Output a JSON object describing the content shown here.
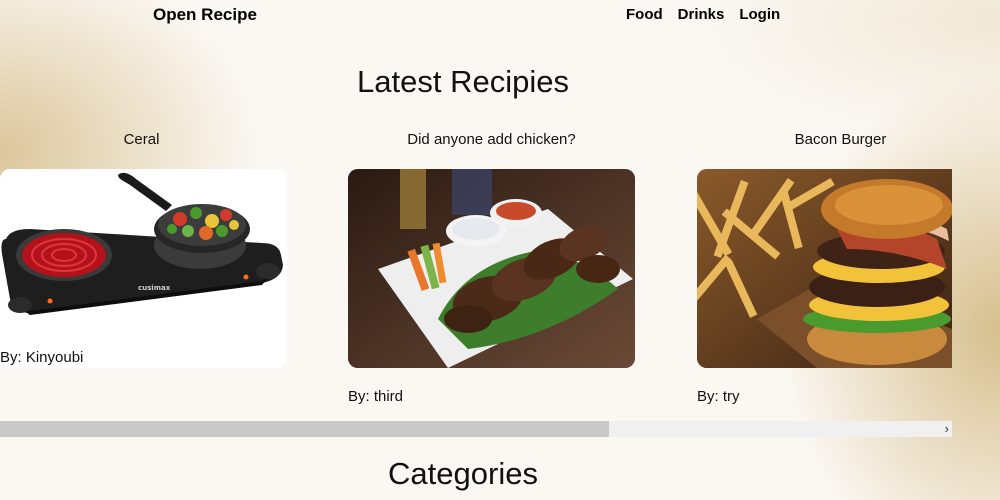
{
  "nav": {
    "brand": "Open Recipe",
    "links": [
      {
        "label": "Food"
      },
      {
        "label": "Drinks"
      },
      {
        "label": "Login"
      }
    ]
  },
  "latest": {
    "title": "Latest Recipies",
    "cards": [
      {
        "title": "Ceral",
        "author": "By: Kinyoubi",
        "image": "electric-hot-plate-with-vegetable-pan"
      },
      {
        "title": "Did anyone add chicken?",
        "author": "By: third",
        "image": "chicken-wings-with-dips"
      },
      {
        "title": "Bacon Burger",
        "author": "By: try",
        "image": "bacon-burger-with-fries"
      }
    ],
    "scroll_position": 0.64
  },
  "categories": {
    "title": "Categories"
  },
  "colors": {
    "background": "#fbf8f3",
    "accent_gold": "#d6be8c",
    "scroll_thumb": "#c9c9c9",
    "scroll_track": "#f0f0f0"
  }
}
